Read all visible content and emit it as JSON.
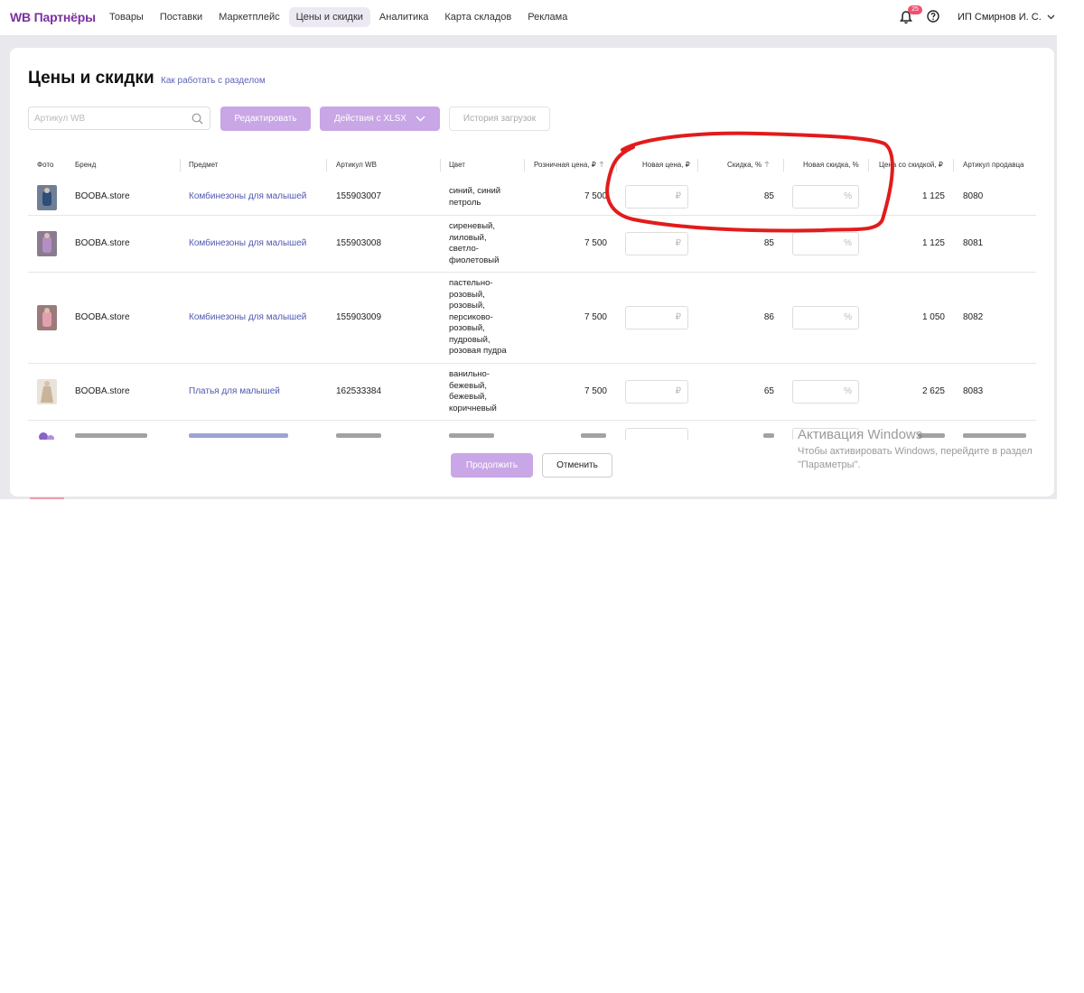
{
  "app": {
    "logo": "WB Партнёры"
  },
  "nav": [
    {
      "label": "Товары",
      "active": false
    },
    {
      "label": "Поставки",
      "active": false
    },
    {
      "label": "Маркетплейс",
      "active": false
    },
    {
      "label": "Цены и скидки",
      "active": true
    },
    {
      "label": "Аналитика",
      "active": false
    },
    {
      "label": "Карта складов",
      "active": false
    },
    {
      "label": "Реклама",
      "active": false
    }
  ],
  "header": {
    "notifications": "25",
    "account": "ИП Смирнов И. С."
  },
  "page": {
    "title": "Цены и скидки",
    "help_link": "Как работать с разделом"
  },
  "toolbar": {
    "search_placeholder": "Артикул WB",
    "edit": "Редактировать",
    "xlsx": "Действия с XLSX",
    "history": "История загрузок"
  },
  "columns": {
    "photo": "Фото",
    "brand": "Бренд",
    "subject": "Предмет",
    "article_wb": "Артикул WB",
    "color": "Цвет",
    "retail_price": "Розничная цена, ₽",
    "new_price": "Новая цена, ₽",
    "discount": "Скидка, %",
    "new_discount": "Новая скидка, %",
    "discounted_price": "Цена со скидкой, ₽",
    "seller_article": "Артикул продавца"
  },
  "rows": [
    {
      "brand": "BOOBA.store",
      "subject": "Комбинезоны для малышей",
      "article_wb": "155903007",
      "color": "синий, синий петроль",
      "retail_price": "7 500",
      "new_price_unit": "₽",
      "discount": "85",
      "new_discount_unit": "%",
      "discounted_price": "1 125",
      "seller_article": "8080"
    },
    {
      "brand": "BOOBA.store",
      "subject": "Комбинезоны для малышей",
      "article_wb": "155903008",
      "color": "сиреневый, лиловый, светло-фиолетовый",
      "retail_price": "7 500",
      "new_price_unit": "₽",
      "discount": "85",
      "new_discount_unit": "%",
      "discounted_price": "1 125",
      "seller_article": "8081"
    },
    {
      "brand": "BOOBA.store",
      "subject": "Комбинезоны для малышей",
      "article_wb": "155903009",
      "color": "пастельно-розовый, розовый, персиково-розовый, пудровый, розовая пудра",
      "retail_price": "7 500",
      "new_price_unit": "₽",
      "discount": "86",
      "new_discount_unit": "%",
      "discounted_price": "1 050",
      "seller_article": "8082"
    },
    {
      "brand": "BOOBA.store",
      "subject": "Платья для малышей",
      "article_wb": "162533384",
      "color": "ванильно-бежевый, бежевый, коричневый",
      "retail_price": "7 500",
      "new_price_unit": "₽",
      "discount": "65",
      "new_discount_unit": "%",
      "discounted_price": "2 625",
      "seller_article": "8083"
    }
  ],
  "footer": {
    "continue": "Продолжить",
    "cancel": "Отменить"
  },
  "watermark": {
    "title": "Активация Windows",
    "text": "Чтобы активировать Windows, перейдите в раздел \"Параметры\"."
  },
  "colors": {
    "accent": "#c9a6e6",
    "logo": "#7b2fa3",
    "link": "#4f58b0",
    "annotation": "#e21b1b"
  }
}
